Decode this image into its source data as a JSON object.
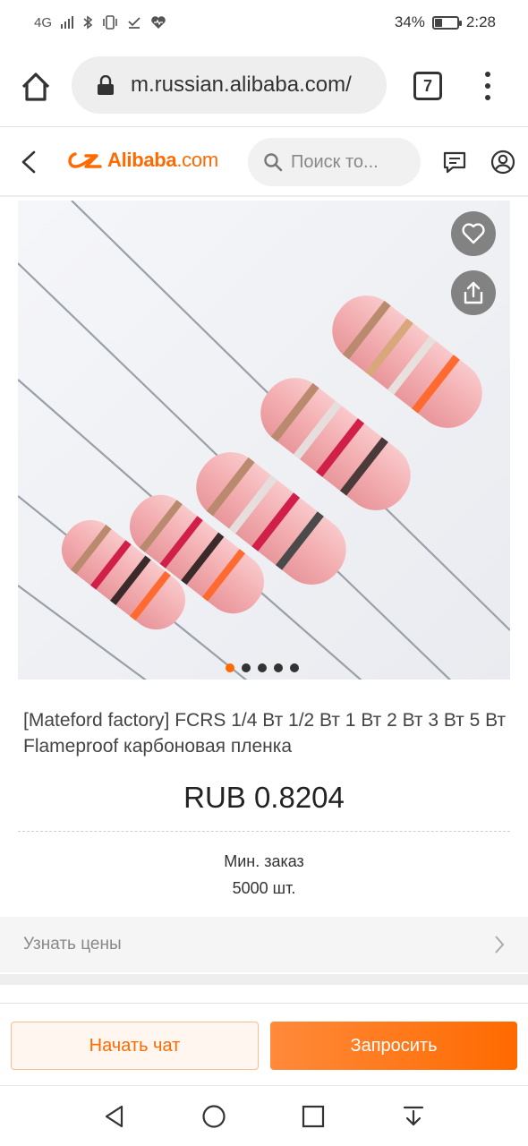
{
  "status_bar": {
    "network": "4G",
    "battery_text": "34%",
    "battery_level": 0.34,
    "time": "2:28"
  },
  "browser": {
    "url": "m.russian.alibaba.com/",
    "tab_count": "7",
    "icons": [
      "home-icon",
      "lock-icon",
      "menu-dots-icon"
    ]
  },
  "header": {
    "logo_brand": "Alibaba",
    "logo_suffix": ".com",
    "search_placeholder": "Поиск то...",
    "icons": [
      "back-icon",
      "search-icon",
      "message-icon",
      "user-icon"
    ]
  },
  "gallery": {
    "image_count": 5,
    "active_index": 0,
    "icons": [
      "heart-icon",
      "share-icon"
    ]
  },
  "product": {
    "title": "[Mateford factory] FCRS 1/4 Вт 1/2 Вт 1 Вт 2 Вт 3 Вт 5 Вт Flameproof карбоновая пленка",
    "price": "RUB 0.8204",
    "moq_label": "Мин. заказ",
    "moq_value": "5000 шт.",
    "price_link": "Узнать цены"
  },
  "actions": {
    "chat_label": "Начать чат",
    "inquiry_label": "Запросить"
  },
  "colors": {
    "accent": "#ff6a00",
    "resistor_body": "#f4b3b5"
  }
}
